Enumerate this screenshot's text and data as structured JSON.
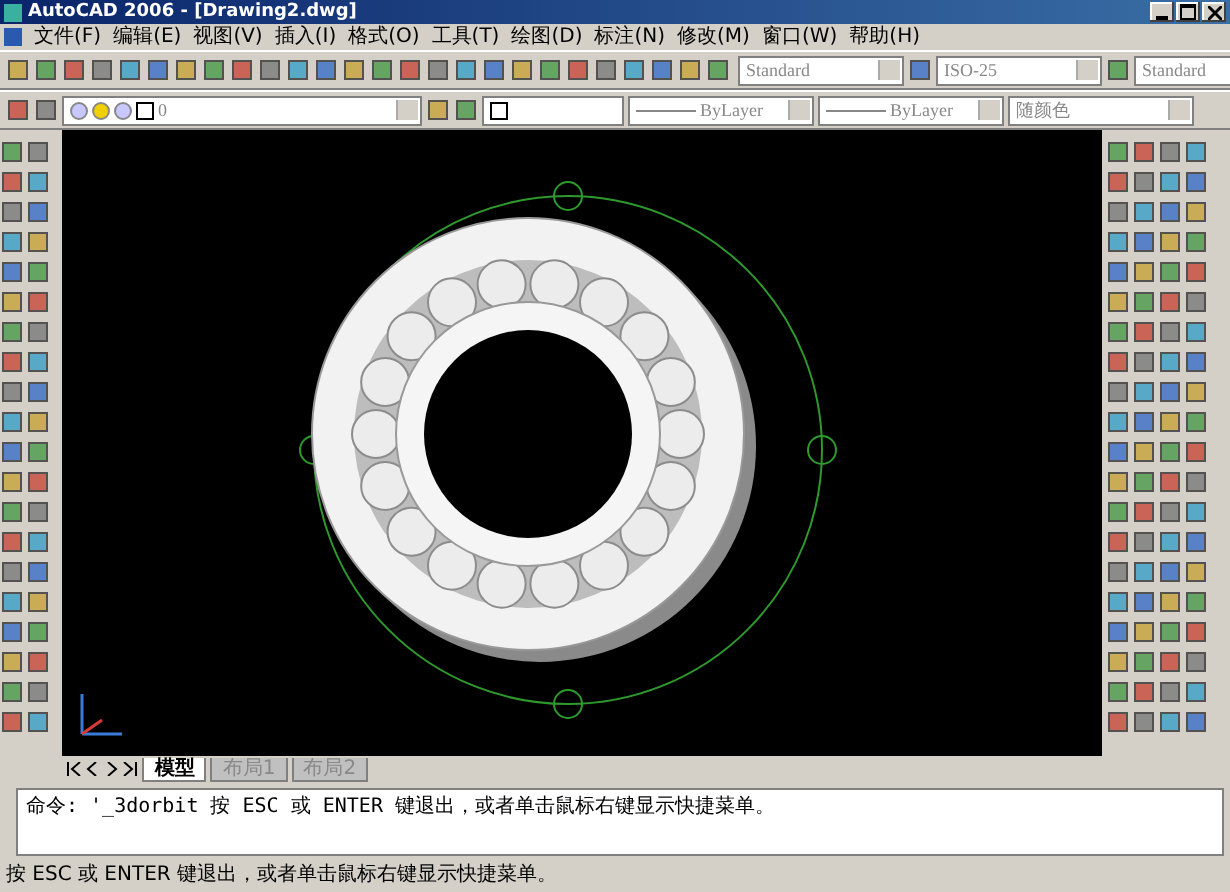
{
  "window": {
    "title": "AutoCAD 2006 - [Drawing2.dwg]"
  },
  "menu": [
    "文件(F)",
    "编辑(E)",
    "视图(V)",
    "插入(I)",
    "格式(O)",
    "工具(T)",
    "绘图(D)",
    "标注(N)",
    "修改(M)",
    "窗口(W)",
    "帮助(H)"
  ],
  "styles_toolbar": {
    "text_style": "Standard",
    "dim_style": "ISO-25",
    "table_style": "Standard"
  },
  "properties_toolbar": {
    "layer": "0",
    "linetype": "ByLayer",
    "lineweight": "ByLayer",
    "plot_style": "随颜色"
  },
  "layout_tabs": [
    {
      "label": "模型",
      "selected": true
    },
    {
      "label": "布局1",
      "selected": false
    },
    {
      "label": "布局2",
      "selected": false
    }
  ],
  "command_line": {
    "history": "命令: '_3dorbit 按 ESC 或 ENTER 键退出，或者单击鼠标右键显示快捷菜单。"
  },
  "status_bar": {
    "text": "按 ESC 或 ENTER 键退出，或者单击鼠标右键显示快捷菜单。"
  }
}
